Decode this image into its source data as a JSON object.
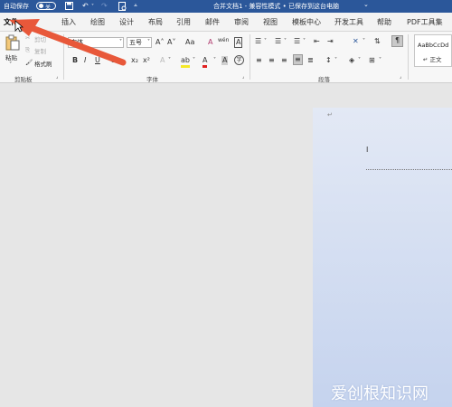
{
  "titlebar": {
    "autosave_label": "自动保存",
    "autosave_state": "关",
    "title": "合并文档1 - 兼容性模式 • 已保存到这台电脑",
    "title_chevron": "⌄",
    "save_icon": "save-icon",
    "undo_icon": "undo-icon",
    "redo_icon": "redo-icon",
    "print_icon": "print-preview-icon",
    "customize_icon": "customize-qat-icon"
  },
  "tabs": [
    "文件",
    "插入",
    "绘图",
    "设计",
    "布局",
    "引用",
    "邮件",
    "审阅",
    "视图",
    "模板中心",
    "开发工具",
    "帮助",
    "PDF工具集"
  ],
  "clipboard": {
    "paste": "粘贴",
    "cut": "剪切",
    "copy": "复制",
    "format_painter": "格式刷",
    "group_label": "剪贴板"
  },
  "font": {
    "font_name": "宋体",
    "font_size": "五号",
    "grow": "A˄",
    "shrink": "A˅",
    "change_case": "Aa",
    "clear_format": "A",
    "phonetic": "wén",
    "border_char": "A",
    "bold": "B",
    "italic": "I",
    "underline": "U",
    "strike": "ab",
    "subscript": "x₂",
    "superscript": "x²",
    "text_effect": "A",
    "highlight": "ab",
    "font_color": "A",
    "shade_char": "A",
    "enclose_char": "字",
    "group_label": "字体"
  },
  "paragraph": {
    "group_label": "段落"
  },
  "styles": {
    "sample": "AaBbCcDd",
    "name": "↵ 正文"
  },
  "document": {
    "para_mark_1": "↵",
    "cursor_mark": "I"
  },
  "watermark": "爱创根知识网",
  "colors": {
    "titlebar": "#2b579a",
    "arrow": "#e8583a",
    "page_top": "#e3e9f5",
    "page_bottom": "#c5d3ee"
  }
}
